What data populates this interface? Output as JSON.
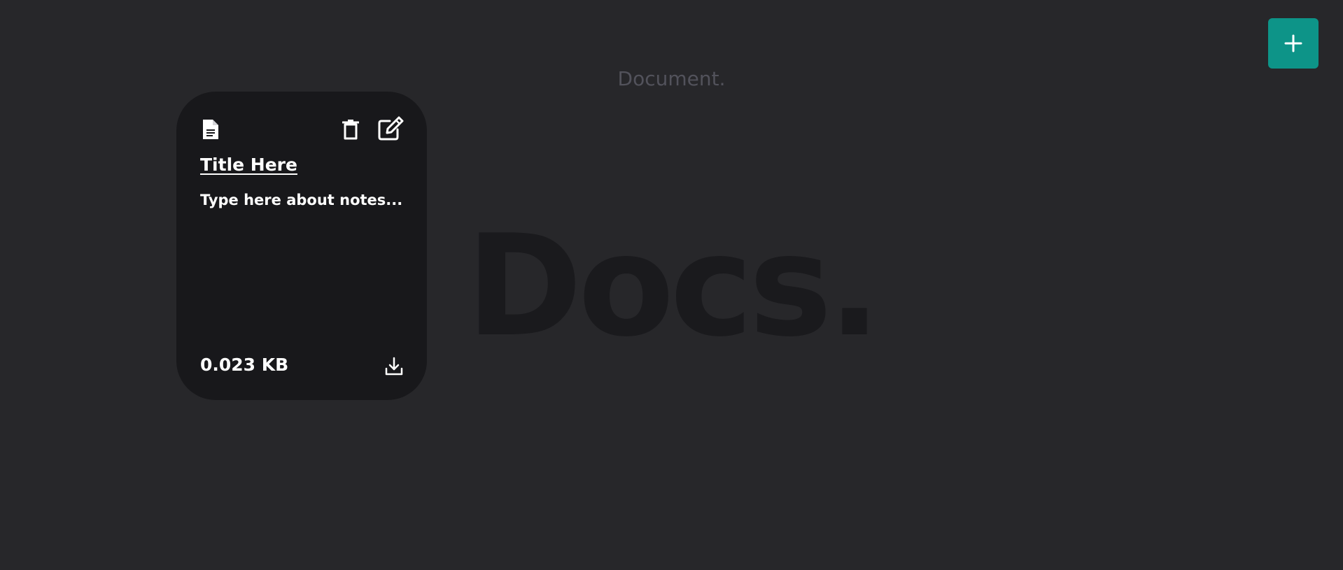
{
  "background": {
    "heading": "Document.",
    "watermark": "Docs."
  },
  "add_button": {
    "icon": "plus-icon",
    "color": "#0d9488"
  },
  "card": {
    "doc_icon": "document-icon",
    "delete_icon": "trash-icon",
    "edit_icon": "edit-icon",
    "download_icon": "download-icon",
    "title": "Title Here",
    "body": "Type here about notes...",
    "size": "0.023 KB"
  },
  "colors": {
    "page_bg": "#27272a",
    "card_bg": "#18181b",
    "accent": "#0d9488"
  }
}
